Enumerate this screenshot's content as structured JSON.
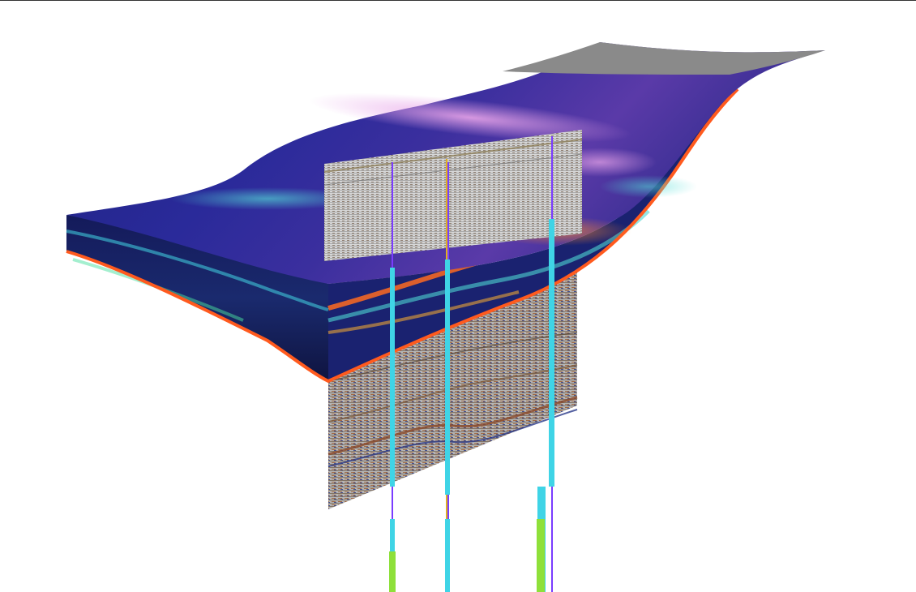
{
  "viewport": {
    "description": "",
    "background": "#ffffff"
  },
  "model": {
    "palette": {
      "deep": "#1b1f7a",
      "mid": "#2a2aa0",
      "cyan": "#3fc7d9",
      "orange": "#ff5a1e",
      "magenta": "#c86ad0",
      "grey_cap": "#8a8a8a"
    }
  },
  "seismic": {
    "colors": [
      "#f2f2f2",
      "#9a9a9a",
      "#5a4a3a",
      "#b06b3a",
      "#2b3a8a"
    ]
  },
  "wells": [
    {
      "name": "",
      "color_top": "#7a3cff",
      "color_log": "#3fd4e6"
    },
    {
      "name": "",
      "color_top": "#7a3cff",
      "color_log": "#3fd4e6"
    },
    {
      "name": "",
      "color_top": "#7a3cff",
      "color_log": "#3fd4e6"
    }
  ]
}
